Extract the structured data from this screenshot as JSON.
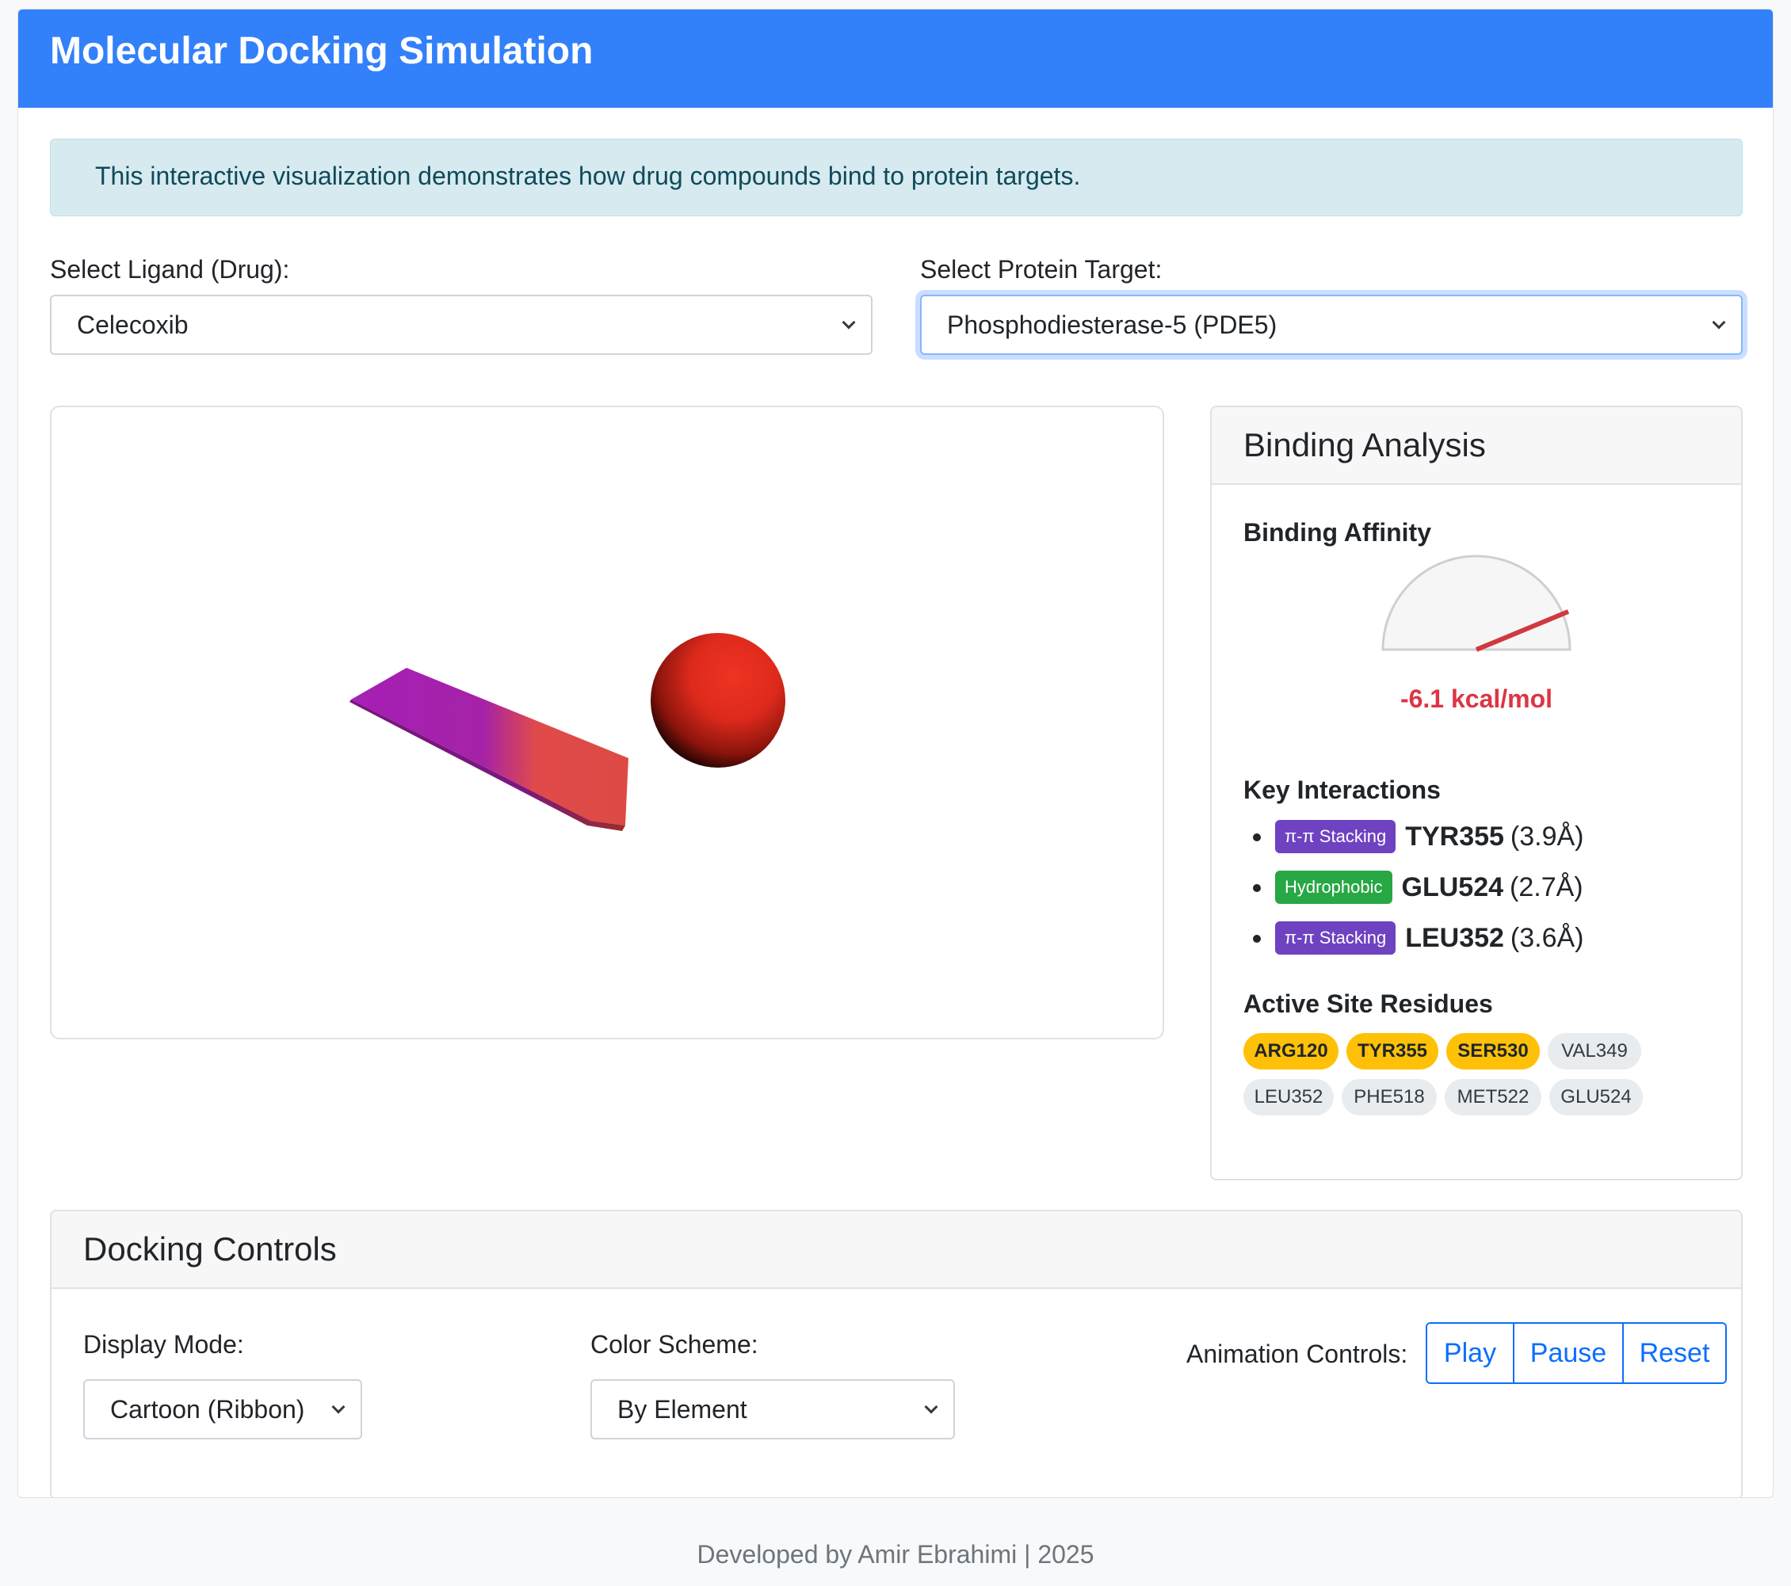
{
  "header": {
    "title": "Molecular Docking Simulation"
  },
  "intro": {
    "text": "This interactive visualization demonstrates how drug compounds bind to protein targets."
  },
  "ligand": {
    "label": "Select Ligand (Drug):",
    "selected": "Celecoxib"
  },
  "protein": {
    "label": "Select Protein Target:",
    "selected": "Phosphodiesterase-5 (PDE5)"
  },
  "analysis": {
    "title": "Binding Analysis",
    "affinity_label": "Binding Affinity",
    "affinity_value": "-6.1 kcal/mol",
    "interactions_label": "Key Interactions",
    "interactions": [
      {
        "type": "π-π Stacking",
        "residue": "TYR355",
        "distance": "(3.9Å)"
      },
      {
        "type": "Hydrophobic",
        "residue": "GLU524",
        "distance": "(2.7Å)"
      },
      {
        "type": "π-π Stacking",
        "residue": "LEU352",
        "distance": "(3.6Å)"
      }
    ],
    "residues_label": "Active Site Residues",
    "residues": [
      "ARG120",
      "TYR355",
      "SER530",
      "VAL349",
      "LEU352",
      "PHE518",
      "MET522",
      "GLU524"
    ]
  },
  "controls": {
    "title": "Docking Controls",
    "display_mode_label": "Display Mode:",
    "display_mode_value": "Cartoon (Ribbon)",
    "color_scheme_label": "Color Scheme:",
    "color_scheme_value": "By Element",
    "animation_label": "Animation Controls:",
    "play": "Play",
    "pause": "Pause",
    "reset": "Reset"
  },
  "footer": {
    "text": "Developed by Amir Ebrahimi | 2025"
  },
  "colors": {
    "header_bg": "#3280fa",
    "affinity": "#dc3545",
    "pi_stacking": "#6f42c1",
    "hydrophobic": "#28a745",
    "highlight_residue": "#ffc107",
    "primary": "#0d6efd"
  }
}
